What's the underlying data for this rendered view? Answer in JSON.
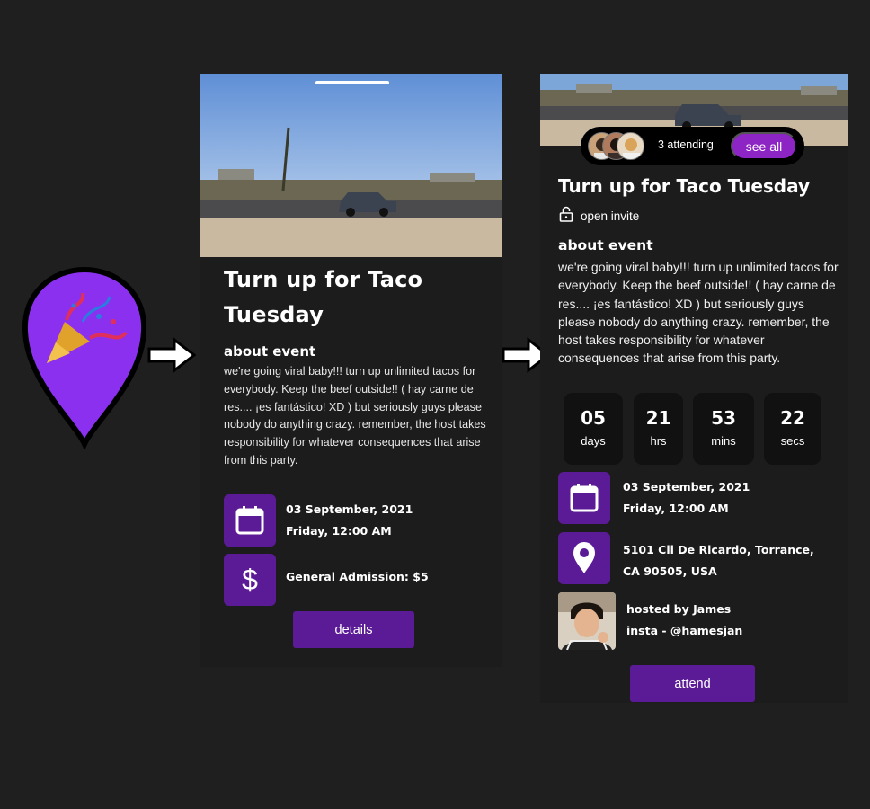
{
  "screen1": {
    "title": "Turn up for Taco Tuesday",
    "about_heading": "about event",
    "description": "we're going viral baby!!! turn up unlimited tacos for everybody. Keep the beef outside!! ( hay carne de res.... ¡es fantástico! XD ) but seriously guys please nobody do anything crazy. remember, the host takes responsibility for whatever consequences that arise from this party.",
    "date_line1": "03 September, 2021",
    "date_line2": "Friday, 12:00 AM",
    "admission": "General Admission: $5",
    "details_button": "details"
  },
  "screen2": {
    "attending_text": "3 attending",
    "see_all_button": "see all",
    "title": "Turn up for Taco Tuesday",
    "invite_type": "open invite",
    "about_heading": "about event",
    "description": "we're going viral baby!!! turn up unlimited tacos for everybody. Keep the beef outside!! ( hay carne de res.... ¡es fantástico! XD ) but seriously guys please nobody do anything crazy. remember, the host takes responsibility for whatever consequences that arise from this party.",
    "countdown": [
      {
        "value": "05",
        "unit": "days"
      },
      {
        "value": "21",
        "unit": "hrs"
      },
      {
        "value": "53",
        "unit": "mins"
      },
      {
        "value": "22",
        "unit": "secs"
      }
    ],
    "date_line1": "03 September, 2021",
    "date_line2": "Friday, 12:00 AM",
    "address_line1": "5101 Cll De Ricardo, Torrance,",
    "address_line2": "CA 90505, USA",
    "host_line1": "hosted by James",
    "host_line2": "insta - @hamesjan",
    "attend_button": "attend"
  },
  "icons": {
    "pin": "party-popper-map-pin-icon",
    "arrow": "right-arrow-icon",
    "calendar": "calendar-icon",
    "dollar": "dollar-icon",
    "location": "location-pin-icon",
    "lock": "unlock-icon"
  },
  "colors": {
    "accent_purple": "#5b1a96",
    "pin_purple": "#8c30f0",
    "see_all_purple": "#8d24c4",
    "background": "#1f1f1f",
    "panel": "#1c1c1c"
  }
}
